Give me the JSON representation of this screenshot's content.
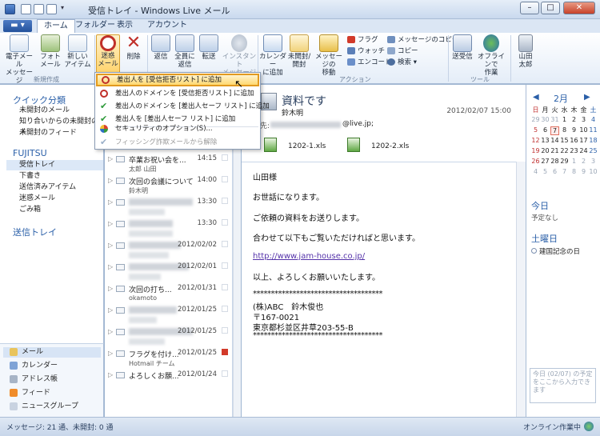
{
  "window": {
    "title": "受信トレイ - Windows Live メール",
    "controls": [
      "–",
      "□",
      "✕"
    ]
  },
  "ribbon_tabs": [
    "ホーム",
    "フォルダー",
    "表示",
    "アカウント"
  ],
  "ribbon": {
    "new_group": {
      "label": "新規作成",
      "buttons": [
        "電子メール\nメッセージ",
        "フォト\nメール",
        "新しい\nアイテム"
      ]
    },
    "delete_group": {
      "buttons": [
        "迷惑\nメール",
        "削除"
      ]
    },
    "respond_group": {
      "buttons": [
        "返信",
        "全員に\n返信",
        "転送",
        "インスタント\nメッセージ"
      ]
    },
    "actions_group": {
      "label": "アクション",
      "buttons": [
        "カレンダー\nに追加",
        "未開封/\n開封",
        "メッセージの\n移動"
      ],
      "small": [
        "フラグ",
        "ウォッチ",
        "エンコード",
        "メッセージのコピー",
        "コピー",
        "検索"
      ]
    },
    "tools_group": {
      "label": "ツール",
      "buttons": [
        "送受信",
        "オフラインで\n作業"
      ]
    },
    "user": "山田\n太郎"
  },
  "leftnav": {
    "quick_views_header": "クイック分類",
    "quick_views": [
      "未開封のメール",
      "知り合いからの未開封のメ",
      "未開封のフィード"
    ],
    "account_header": "FUJITSU",
    "folders": [
      "受信トレイ",
      "下書き",
      "送信済みアイテム",
      "迷惑メール",
      "ごみ箱"
    ],
    "outbox": "送信トレイ",
    "bottom": [
      "メール",
      "カレンダー",
      "アドレス帳",
      "フィード",
      "ニュースグループ"
    ]
  },
  "messages": [
    {
      "subject": "卒業お祝い会を...",
      "from": "太郎 山田",
      "date": "14:15",
      "blurred": false
    },
    {
      "subject": "次回の会議について",
      "from": "鈴木明",
      "date": "14:00",
      "blurred": false
    },
    {
      "subject": "",
      "from": "",
      "date": "13:30",
      "blurred": true
    },
    {
      "subject": "",
      "from": "",
      "date": "13:30",
      "blurred": true
    },
    {
      "subject": "",
      "from": "",
      "date": "2012/02/02",
      "blurred": true
    },
    {
      "subject": "",
      "from": "",
      "date": "2012/02/01",
      "blurred": true
    },
    {
      "subject": "次回の打ち...",
      "from": "okamoto",
      "date": "2012/01/31",
      "blurred": false
    },
    {
      "subject": "",
      "from": "",
      "date": "2012/01/25",
      "blurred": true
    },
    {
      "subject": "",
      "from": "",
      "date": "2012/01/25",
      "blurred": true
    },
    {
      "subject": "フラグを付け...",
      "from": "Hotmail チーム",
      "date": "2012/01/25",
      "blurred": false
    },
    {
      "subject": "よろしくお願...",
      "from": "",
      "date": "2012/01/24",
      "blurred": false
    }
  ],
  "reading": {
    "subject": "資料です",
    "sender": "鈴木明",
    "date": "2012/02/07 15:00",
    "to_label": "宛先:",
    "to_suffix": "@live.jp;",
    "attachments": [
      "1202-1.xls",
      "1202-2.xls"
    ],
    "body": [
      "山田様",
      "お世話になります。",
      "ご依頼の資料をお送りします。",
      "合わせて以下もご覧いただければと思います。",
      "http://www.jam-house.co.jp/",
      "以上、よろしくお願いいたします。",
      "************************************",
      "(株)ABC　鈴木俊也",
      "〒167-0021",
      "東京都杉並区井草203-55-B",
      "************************************"
    ]
  },
  "dropdown": {
    "items": [
      "差出人を [受信拒否リスト] に追加",
      "差出人のドメインを [受信拒否リスト] に追加",
      "差出人のドメインを [差出人セーフ リスト] に追加",
      "差出人を [差出人セーフ リスト] に追加",
      "セキュリティのオプション(S)...",
      "フィッシング詐欺メールから解除"
    ]
  },
  "calendar": {
    "month": "2月",
    "weekdays": [
      "日",
      "月",
      "火",
      "水",
      "木",
      "金",
      "土"
    ],
    "weeks": [
      [
        "29",
        "30",
        "31",
        "1",
        "2",
        "3",
        "4"
      ],
      [
        "5",
        "6",
        "7",
        "8",
        "9",
        "10",
        "11"
      ],
      [
        "12",
        "13",
        "14",
        "15",
        "16",
        "17",
        "18"
      ],
      [
        "19",
        "20",
        "21",
        "22",
        "23",
        "24",
        "25"
      ],
      [
        "26",
        "27",
        "28",
        "29",
        "1",
        "2",
        "3"
      ],
      [
        "4",
        "5",
        "6",
        "7",
        "8",
        "9",
        "10"
      ]
    ],
    "today_label": "今日",
    "today_note": "予定なし",
    "saturday_label": "土曜日",
    "saturday_event": "建国記念の日",
    "quick_add": "今日 (02/07) の予定をここから入力できます"
  },
  "status": {
    "left": "メッセージ: 21 通、未開封: 0 通",
    "right": "オンライン作業中"
  },
  "colors": {
    "accent": "#2a5fa8",
    "highlight_border": "#e29a1f",
    "block_icon": "#c0302a",
    "safe_icon": "#2e9a3a"
  }
}
